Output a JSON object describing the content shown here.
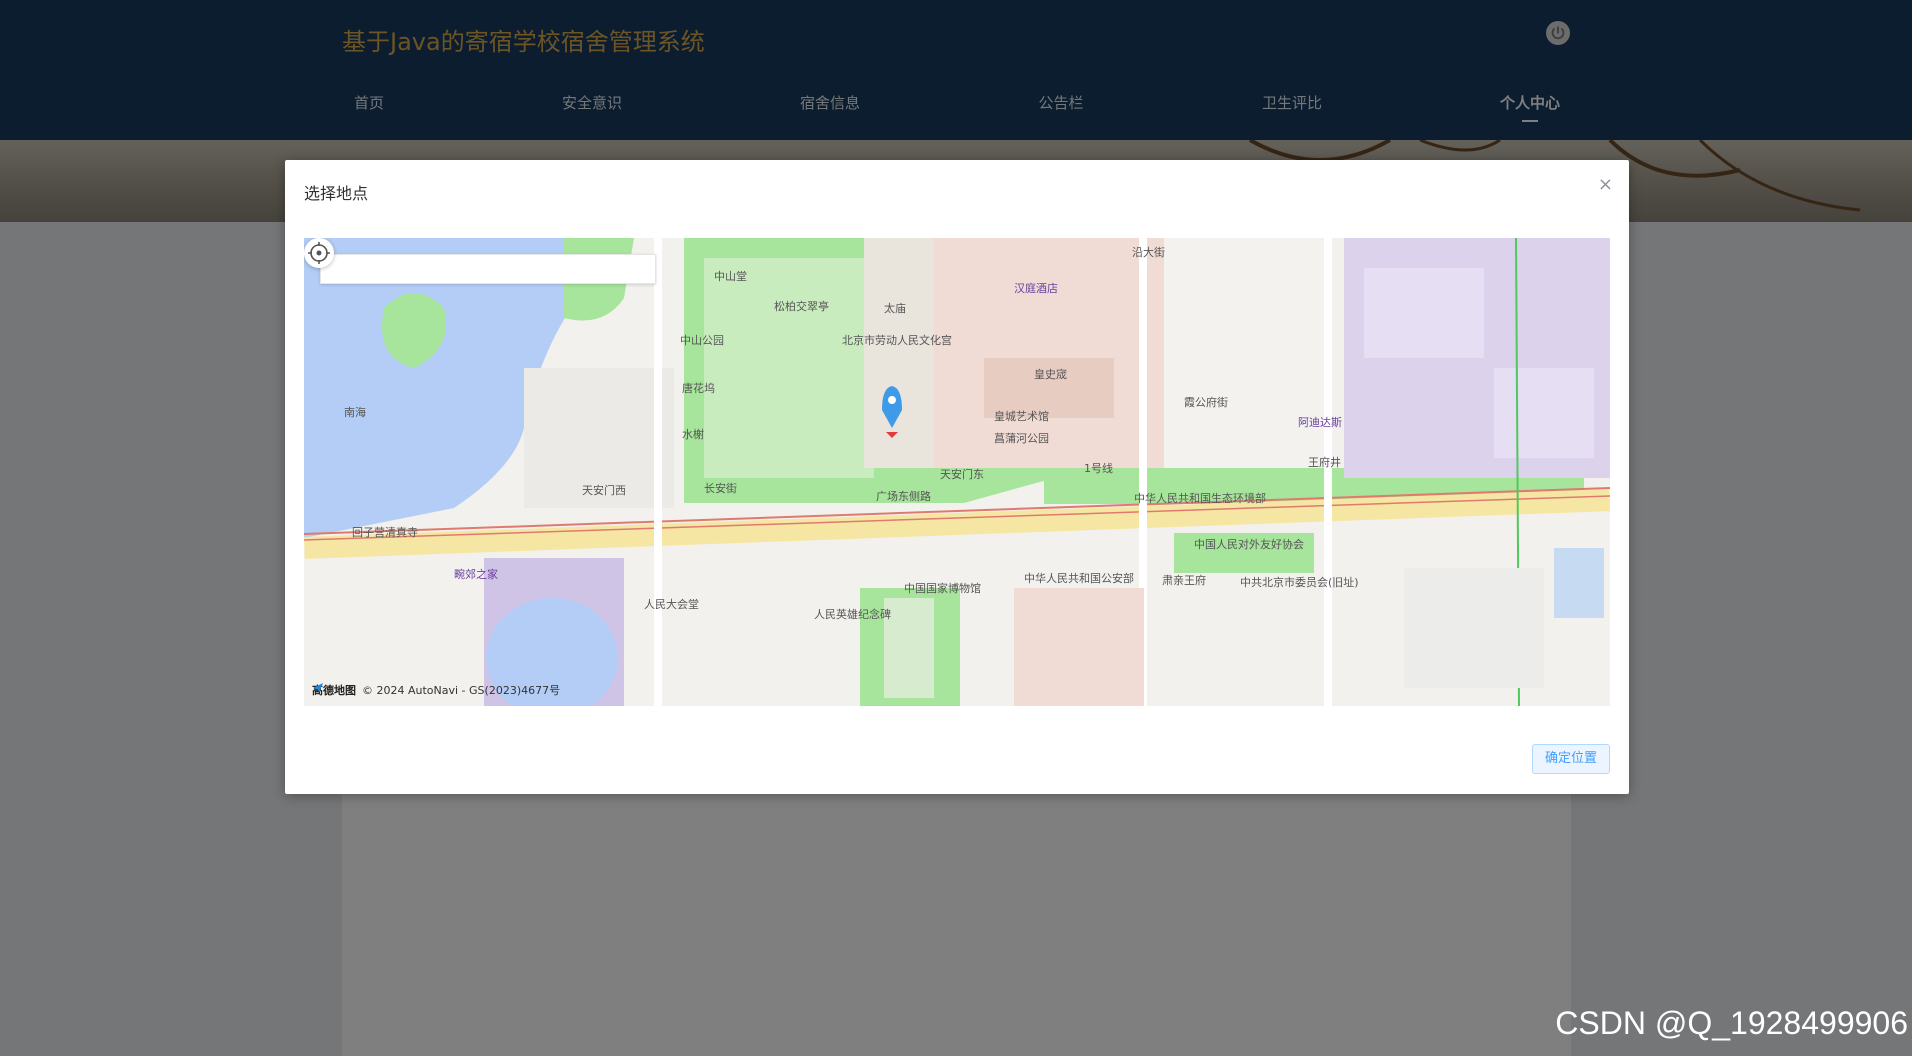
{
  "header": {
    "site_title": "基于Java的寄宿学校宿舍管理系统",
    "power_icon": "power-icon",
    "nav": [
      {
        "label": "首页"
      },
      {
        "label": "安全意识"
      },
      {
        "label": "宿舍信息"
      },
      {
        "label": "公告栏"
      },
      {
        "label": "卫生评比"
      },
      {
        "label": "个人中心",
        "active": true
      }
    ]
  },
  "dialog": {
    "title": "选择地点",
    "close_glyph": "×",
    "close_icon": "close-icon",
    "confirm_label": "确定位置",
    "map": {
      "search_value": "",
      "attribution": "© 2024 AutoNavi - GS(2023)4677号",
      "logo_text": "高德地图",
      "locate_icon": "crosshair-icon",
      "marker_icon": "location-pin-icon",
      "labels": [
        "中山堂",
        "松柏交翠亭",
        "太庙",
        "北京市劳动人民文化宫",
        "中山公园",
        "汉庭酒店",
        "皇史宬",
        "皇城艺术馆",
        "菖蒲河公园",
        "南海",
        "唐花坞",
        "水榭",
        "天安门西",
        "长安街",
        "天安门东",
        "1号线",
        "王府井",
        "阿迪达斯",
        "中华人民共和国生态环境部",
        "中国人民对外友好协会",
        "回子营清真寺",
        "畹郊之家",
        "人民大会堂",
        "人民英雄纪念碑",
        "中国国家博物馆",
        "中华人民共和国公安部",
        "肃亲王府",
        "中共北京市委员会(旧址)",
        "广场东侧路",
        "沿大街",
        "霞公府街"
      ]
    }
  },
  "watermark": "CSDN @Q_1928499906"
}
